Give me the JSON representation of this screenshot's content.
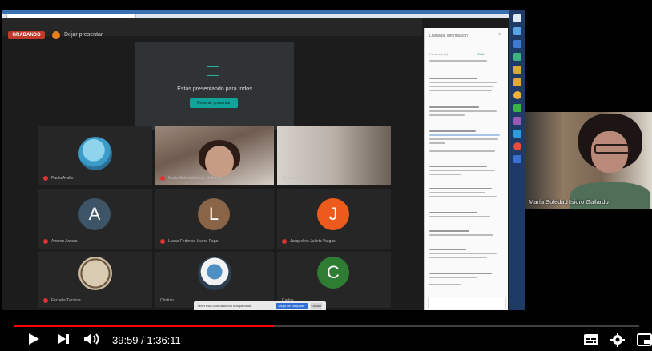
{
  "meeting": {
    "record_label": "GRABANDO",
    "stop_presenting_label": "Dejar presentar",
    "presenting_text": "Estás presentando para todos",
    "stop_presenting_button": "Dejar de presentar"
  },
  "participants": [
    {
      "name": "Paula Avallo",
      "initial": "",
      "color": ""
    },
    {
      "name": "María Soledad Isidro Gallardo",
      "initial": "",
      "color": ""
    },
    {
      "name": "Tomás Cortés",
      "initial": "",
      "color": ""
    },
    {
      "name": "Andrea Acosta",
      "initial": "A",
      "color": "#3d5566"
    },
    {
      "name": "Lucas Federico Livera Paga",
      "initial": "L",
      "color": "#8a6446"
    },
    {
      "name": "Jacqueline Julieta Vargas",
      "initial": "J",
      "color": "#ec5b1b"
    },
    {
      "name": "Escuela Técnica",
      "initial": "",
      "color": ""
    },
    {
      "name": "Cristian",
      "initial": "",
      "color": ""
    },
    {
      "name": "Carlos",
      "initial": "C",
      "color": "#2e7d32"
    }
  ],
  "chat": {
    "title": "Llamada: informacion",
    "tab_people": "Personas (9)",
    "tab_chat": "Chat"
  },
  "screen_share": {
    "notice": "Meet está compartiendo una pantalla",
    "stop_button": "Dejar de compartir",
    "hide_button": "Ocultar"
  },
  "webcam": {
    "name": "María Soledad Isidro Gallardo"
  },
  "player": {
    "time": "39:59 / 1:36:11",
    "progress_fraction": 0.4157,
    "progress_color": "#ff0000"
  }
}
